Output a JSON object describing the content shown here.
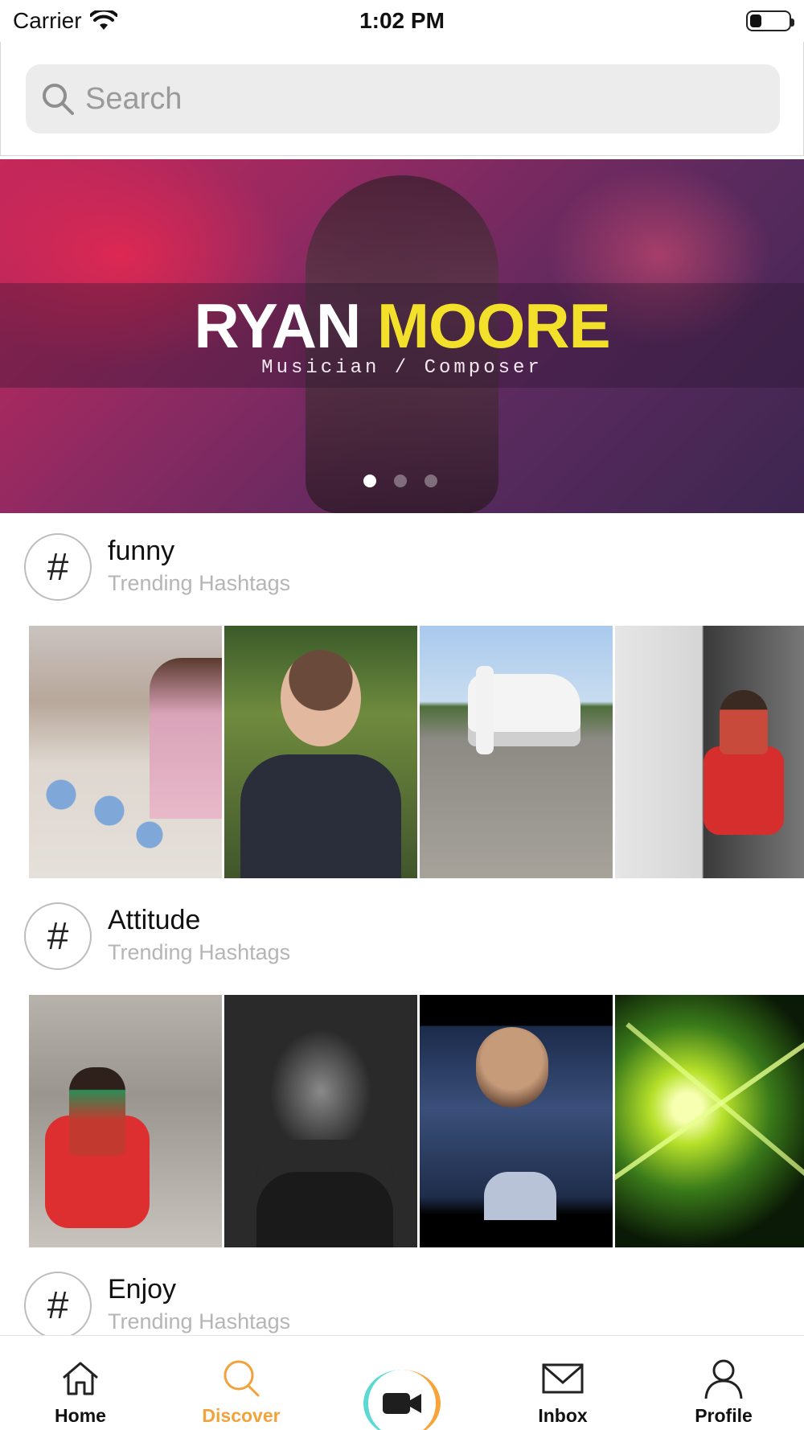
{
  "status_bar": {
    "carrier": "Carrier",
    "time": "1:02 PM",
    "battery_level": 0.3
  },
  "search": {
    "placeholder": "Search"
  },
  "banner": {
    "title_first": "RYAN",
    "title_last": "MOORE",
    "subtitle": "Musician / Composer",
    "pages": 3,
    "active_page": 1,
    "colors": {
      "first": "#ffffff",
      "last": "#f3e02a"
    }
  },
  "hashtags": [
    {
      "symbol": "#",
      "name": "funny",
      "caption": "Trending Hashtags"
    },
    {
      "symbol": "#",
      "name": "Attitude",
      "caption": "Trending Hashtags"
    },
    {
      "symbol": "#",
      "name": "Enjoy",
      "caption": "Trending Hashtags"
    }
  ],
  "tab_bar": {
    "active": "Discover",
    "accent": "#f2a23a",
    "tabs": [
      {
        "label": "Home",
        "icon": "home-icon"
      },
      {
        "label": "Discover",
        "icon": "search-icon"
      },
      {
        "label": "",
        "icon": "video-camera-icon"
      },
      {
        "label": "Inbox",
        "icon": "mail-icon"
      },
      {
        "label": "Profile",
        "icon": "person-icon"
      }
    ]
  }
}
